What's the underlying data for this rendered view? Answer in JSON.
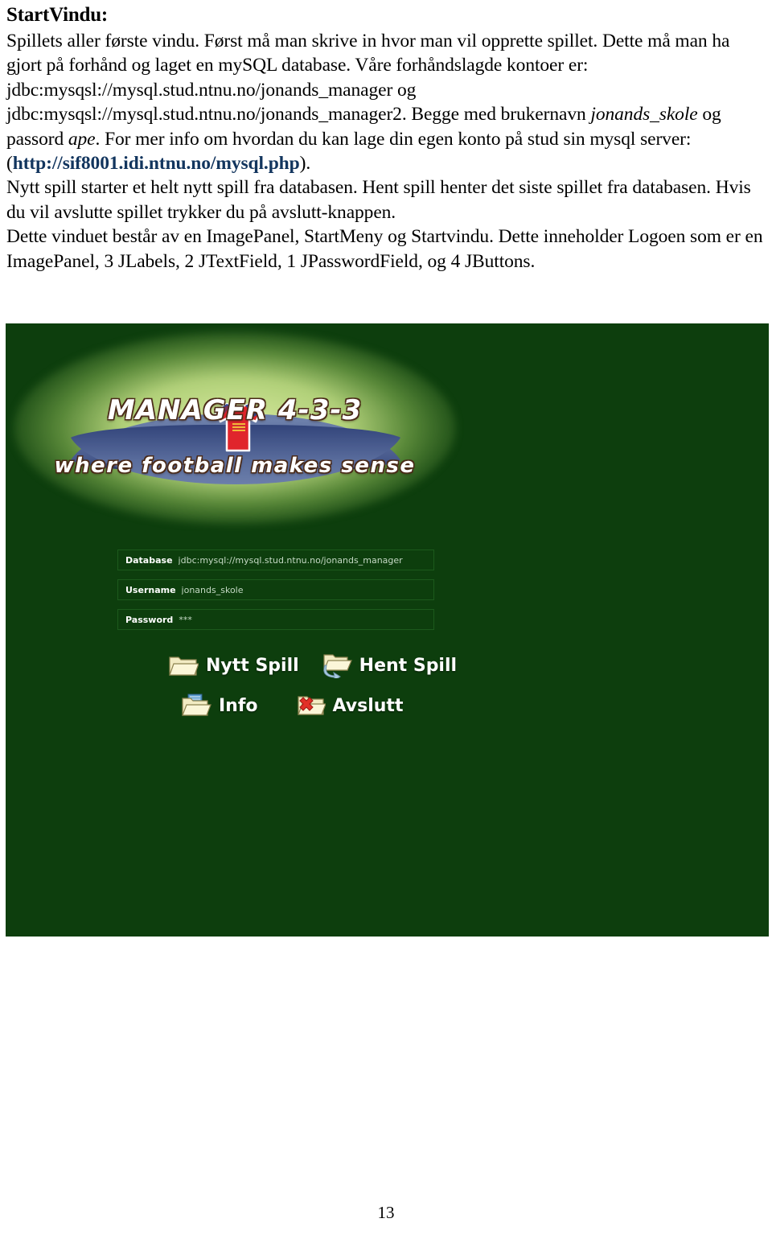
{
  "document": {
    "heading": "StartVindu:",
    "paragraph": "Spillets aller første vindu. Først må man skrive in hvor man vil opprette spillet. Dette må man ha gjort på forhånd og laget en mySQL database. Våre forhåndslagde kontoer er: jdbc:mysqsl://mysql.stud.ntnu.no/jonands_manager  og jdbc:mysqsl://mysql.stud.ntnu.no/jonands_manager2. Begge med brukernavn ",
    "italic_username": "jonands_skole",
    "mid_text_1": " og passord ",
    "italic_password": "ape",
    "mid_text_2": ". For mer info om hvordan du kan lage din egen konto på stud sin mysql server: (",
    "url": "http://sif8001.idi.ntnu.no/mysql.php",
    "mid_text_3": ").",
    "paragraph_2": "Nytt spill starter et helt nytt spill fra databasen. Hent spill henter det siste spillet fra databasen. Hvis du vil avslutte spillet trykker du på avslutt-knappen.",
    "paragraph_3": "Dette vinduet består av en ImagePanel, StartMeny og Startvindu. Dette inneholder Logoen som er en ImagePanel, 3 JLabels, 2 JTextField, 1 JPasswordField, og 4 JButtons.",
    "page_number": "13"
  },
  "app": {
    "background_color": "#0d3e0d",
    "logo": {
      "title": "MANAGER 4-3-3",
      "tagline": "where football makes sense",
      "jersey_color": "#e0252c",
      "lens_color": "#4a5e92",
      "glow_color": "#e4f4a8"
    },
    "form": {
      "fields": [
        {
          "label": "Database",
          "value": "jdbc:mysql://mysql.stud.ntnu.no/jonands_manager"
        },
        {
          "label": "Username",
          "value": "jonands_skole"
        },
        {
          "label": "Password",
          "value": "***"
        }
      ]
    },
    "buttons": [
      {
        "label": "Nytt Spill",
        "icon": "folder-icon"
      },
      {
        "label": "Hent Spill",
        "icon": "folder-open-arrow-icon"
      },
      {
        "label": "Info",
        "icon": "folder-document-icon"
      },
      {
        "label": "Avslutt",
        "icon": "folder-red-x-icon"
      }
    ]
  }
}
